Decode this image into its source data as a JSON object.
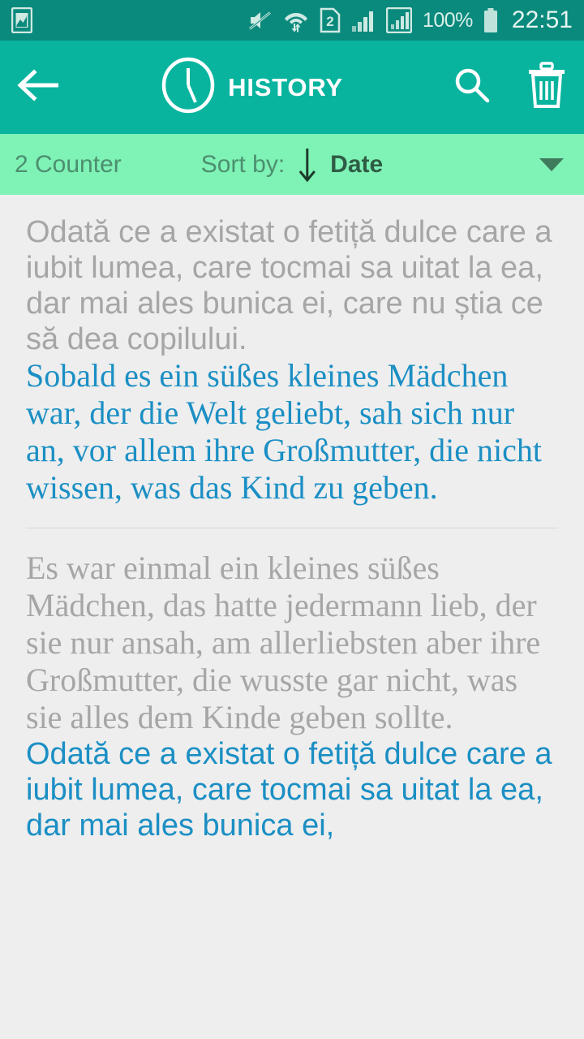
{
  "status_bar": {
    "icons": [
      "image-icon",
      "mute-icon",
      "wifi-transfer-icon",
      "sim2-icon",
      "signal-icon",
      "signal-boxed-icon"
    ],
    "battery_percent": "100%",
    "battery_icon": "battery-full-icon",
    "clock": "22:51",
    "bg_color": "#0a8a7d",
    "fg_color": "#e6f5f1"
  },
  "app_bar": {
    "back_icon": "arrow-left-icon",
    "title_icon": "clock-icon",
    "title": "HISTORY",
    "search_icon": "search-icon",
    "delete_icon": "trash-icon",
    "bg_color": "#08b49e",
    "fg_color": "#ffffff"
  },
  "sort_bar": {
    "counter": "2 Counter",
    "sort_label": "Sort by:",
    "sort_direction_icon": "arrow-down-icon",
    "sort_value": "Date",
    "dropdown_icon": "caret-down-icon",
    "bg_color": "#7ff2b6",
    "label_color": "#4c8f6e",
    "value_color": "#2f5c45"
  },
  "history": {
    "grey_color": "#a6a6a6",
    "blue_color": "#1b8fc4",
    "entries": [
      {
        "source_text": "Odată ce a existat o fetiță dulce care a iubit lumea, care tocmai sa uitat la ea, dar mai ales bunica ei, care nu știa ce să dea copilului.",
        "source_style": "sans-grey",
        "target_text": "Sobald es ein süßes kleines Mädchen war, der die Welt geliebt, sah sich nur an, vor allem ihre Großmutter, die nicht wissen, was das Kind zu geben.",
        "target_style": "serif-blue"
      },
      {
        "source_text": "Es war einmal ein kleines süßes Mädchen, das hatte jedermann lieb, der sie nur ansah, am allerliebsten aber ihre Großmutter, die wusste gar nicht, was sie alles dem Kinde geben sollte.",
        "source_style": "serif-grey",
        "target_text": "Odată ce a existat o fetiță dulce care a iubit lumea, care tocmai sa uitat la ea, dar mai ales bunica ei,",
        "target_style": "sans-blue"
      }
    ]
  }
}
